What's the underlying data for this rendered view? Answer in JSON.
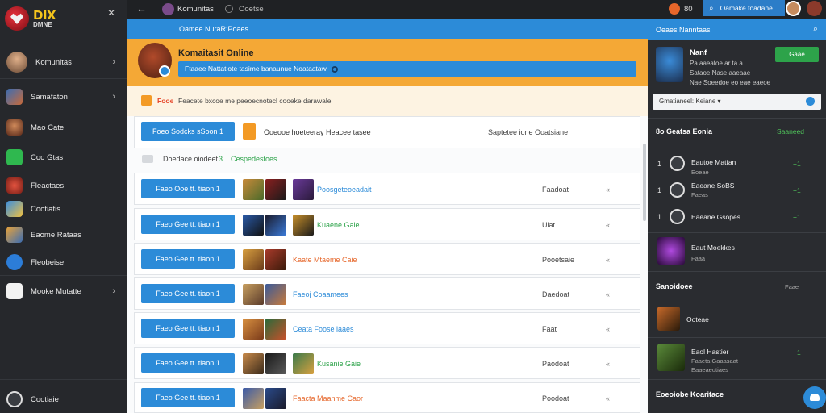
{
  "sidebar": {
    "logo_big": "DIX",
    "logo_small": "DMNE",
    "items": [
      {
        "label": "Komunitas",
        "icon": "profile-icon",
        "chevron": "›"
      },
      {
        "label": "Samafaton",
        "icon": "game-icon",
        "chevron": "›"
      },
      {
        "label": "Mao Cate",
        "icon": "character-icon"
      },
      {
        "label": "Coo Gtas",
        "icon": "chat-icon"
      },
      {
        "label": "Fleactaes",
        "icon": "game-icon"
      },
      {
        "label": "Cootiatis",
        "icon": "game-icon"
      },
      {
        "label": "Eaome Rataas",
        "icon": "game-icon"
      },
      {
        "label": "Fleobeise",
        "icon": "bluetooth-icon"
      },
      {
        "label": "Mooke Mutatte",
        "icon": "refresh-icon",
        "chevron": "›"
      },
      {
        "label": "Cootiaie",
        "icon": "settings-icon"
      }
    ]
  },
  "topbar": {
    "back": "←",
    "crumb1": "Komunitas",
    "crumb2": "Ooetse",
    "coin_value": "80",
    "search_label": "Oamake toadane"
  },
  "main": {
    "header": "Oamee NuraR:Poaes",
    "banner_title": "Komaitasit Online",
    "banner_bar": "Ftaaee Nattatiote tasime banaunue Noataataw",
    "notice_key": "Fooe",
    "notice_text": "Feacete bxcoe me peeoecnotecl cooeke darawale",
    "first_row": {
      "button": "Foeo Sodcks sSoon 1",
      "name": "Ooeooe hoeteeray Heacee tasee",
      "stat": "Saptetee ione Ooatsiane"
    },
    "section_t1": "Doedace oiodeet",
    "section_t2": "3",
    "section_t3": "Cespedestoes",
    "rows": [
      {
        "button": "Faeo Ooe tt. tiaon 1",
        "name": "Poosgeteoeadait",
        "stat": "Faadoat",
        "arrow": "«"
      },
      {
        "button": "Faeo Gee tt. tiaon 1",
        "name": "Kuaene Gaie",
        "stat": "Uiat",
        "arrow": "«"
      },
      {
        "button": "Faeo Gee tt. tiaon 1",
        "name": "Kaate Mtaeme Caie",
        "stat": "Pooetsaie",
        "arrow": "«"
      },
      {
        "button": "Faeo Gee tt. tiaon 1",
        "name": "Faeoj Coaamees",
        "stat": "Daedoat",
        "arrow": "«"
      },
      {
        "button": "Faeo Gee tt. tiaon 1",
        "name": "Ceata Foose iaaes",
        "stat": "Faat",
        "arrow": "«"
      },
      {
        "button": "Faeo Gee tt. tiaon 1",
        "name": "Kusanie Gaie",
        "stat": "Paodoat",
        "arrow": "«"
      },
      {
        "button": "Faeo Gee tt. tiaon 1",
        "name": "Faacta Maanme Caor",
        "stat": "Poodoat",
        "arrow": "«"
      }
    ]
  },
  "right_panel": {
    "header": "Oeaes Nanntaas",
    "profile_name": "Nanf",
    "profile_l2": "Pa aaeatoe ar ta a",
    "profile_l3": "Sataoe Nase aaeaae",
    "profile_l4": "Nae Soeedoe eo eae eaeoe",
    "profile_btn": "Gaae",
    "search_text": "Gmatianeel: Keiane",
    "section1_title": "8o Geatsa Eonia",
    "section1_green": "Saaneed",
    "ranked": [
      {
        "num": "1",
        "name": "Eautoe Matfan",
        "sub": "Eoeae",
        "mark": "+1"
      },
      {
        "num": "1",
        "name": "Eaeane SoBS",
        "sub": "Faeas",
        "mark": "+1"
      },
      {
        "num": "1",
        "name": "Eaeane Gsopes",
        "sub": "",
        "mark": "+1"
      }
    ],
    "feature_name": "Eaut Moekkes",
    "feature_sub": "Faaa",
    "section2_title": "Sanoidoee",
    "section2_right": "Faae",
    "card3_name": "Ooteae",
    "card4_name": "Eaol Hastier",
    "card4_sub1": "Faaeta Gaaasaat",
    "card4_sub2": "Eaaeaeutiaes",
    "section3_title": "Eoeoiobe Koaritace"
  }
}
